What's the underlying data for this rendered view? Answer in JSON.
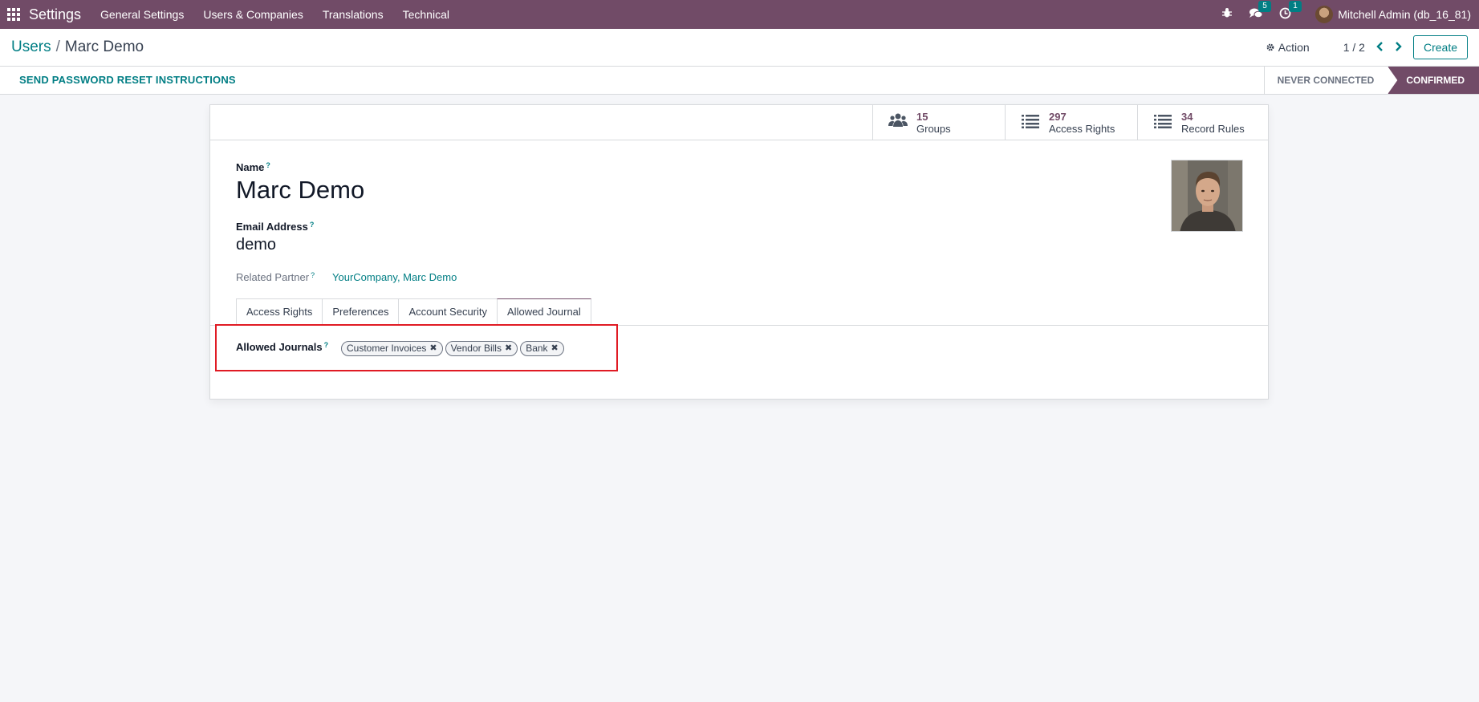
{
  "navbar": {
    "app_name": "Settings",
    "menu": [
      "General Settings",
      "Users & Companies",
      "Translations",
      "Technical"
    ],
    "messages_count": "5",
    "activities_count": "1",
    "user": "Mitchell Admin (db_16_81)",
    "icons": [
      "apps-grid-icon",
      "bug-icon",
      "chat-icon",
      "clock-icon"
    ]
  },
  "control": {
    "breadcrumb_parent": "Users",
    "breadcrumb_sep": "/",
    "breadcrumb_current": "Marc Demo",
    "action_label": "Action",
    "pager": "1 / 2",
    "prev": "‹",
    "next": "›",
    "create_label": "Create"
  },
  "statusbar": {
    "reset_label": "SEND PASSWORD RESET INSTRUCTIONS",
    "states": [
      "NEVER CONNECTED",
      "CONFIRMED"
    ],
    "active_state": "CONFIRMED"
  },
  "stat_buttons": [
    {
      "count": "15",
      "label": "Groups",
      "icon": "users-icon"
    },
    {
      "count": "297",
      "label": "Access Rights",
      "icon": "list-icon"
    },
    {
      "count": "34",
      "label": "Record Rules",
      "icon": "list-icon"
    }
  ],
  "form": {
    "name_label": "Name",
    "name_value": "Marc Demo",
    "email_label": "Email Address",
    "email_value": "demo",
    "partner_label": "Related Partner",
    "partner_value": "YourCompany, Marc Demo",
    "help_mark": "?"
  },
  "tabs": [
    "Access Rights",
    "Preferences",
    "Account Security",
    "Allowed Journal"
  ],
  "active_tab": "Allowed Journal",
  "allowed_journals": {
    "label": "Allowed Journals",
    "tags": [
      "Customer Invoices",
      "Vendor Bills",
      "Bank"
    ],
    "remove_glyph": "✖"
  },
  "colors": {
    "brand": "#714b67",
    "accent": "#017e84",
    "highlight": "#e01b24"
  }
}
